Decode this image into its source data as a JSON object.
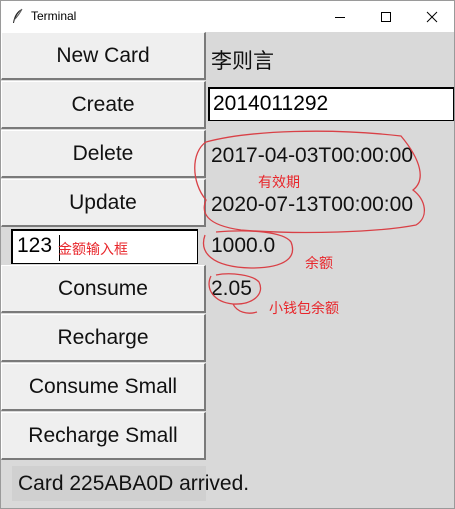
{
  "window": {
    "title": "Terminal"
  },
  "buttons": {
    "new_card": "New Card",
    "create": "Create",
    "delete": "Delete",
    "update": "Update",
    "consume": "Consume",
    "recharge": "Recharge",
    "consume_small": "Consume Small",
    "recharge_small": "Recharge Small"
  },
  "amount_input": {
    "value": "123"
  },
  "card": {
    "holder_name": "李则言",
    "card_number": "2014011292",
    "valid_from": "2017-04-03T00:00:00",
    "valid_to": "2020-07-13T00:00:00",
    "balance": "1000.0",
    "small_wallet_balance": "2.05"
  },
  "annotations": {
    "amount_input_note": "金额输入框",
    "validity_note": "有效期",
    "balance_note": "余额",
    "small_wallet_note": "小钱包余额",
    "color": "#e8262b"
  },
  "status": {
    "message": "Card 225ABA0D arrived."
  }
}
